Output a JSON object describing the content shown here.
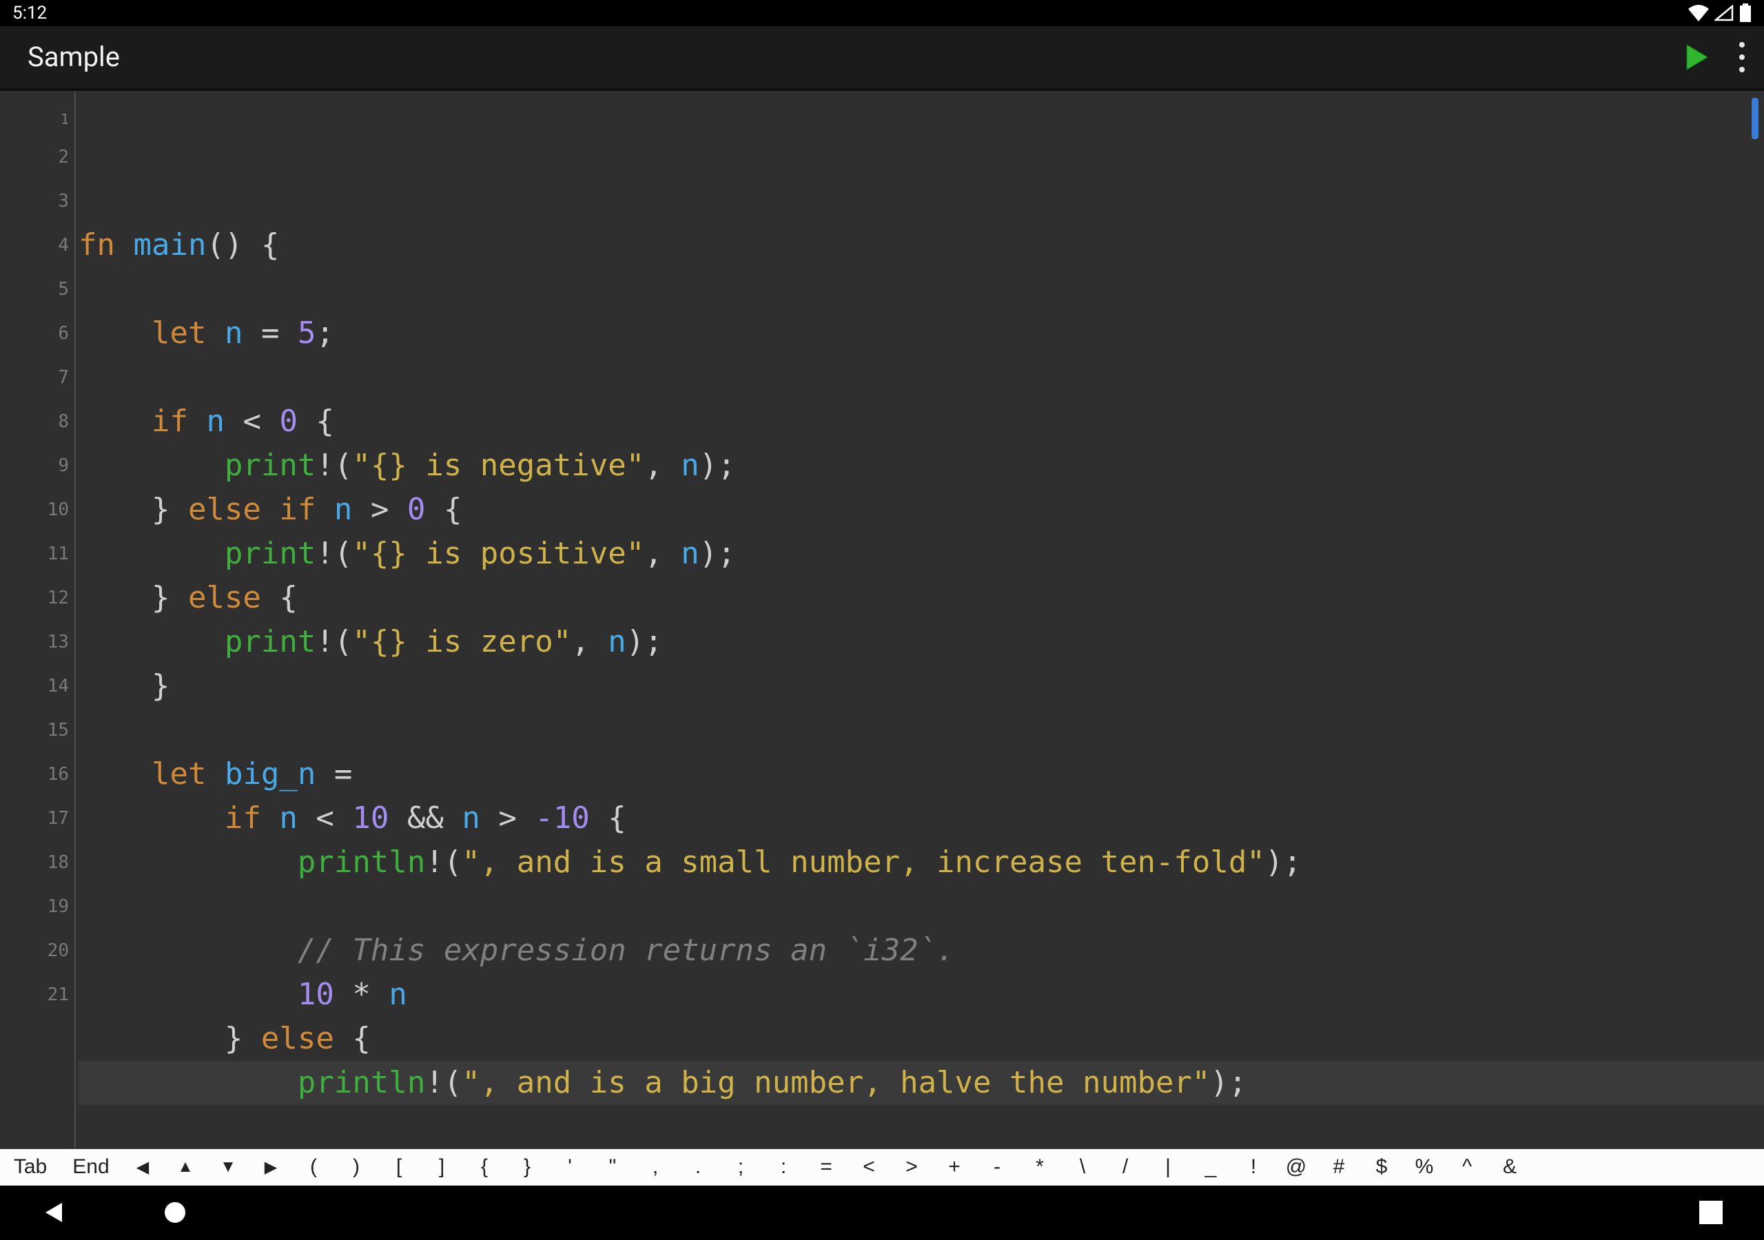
{
  "status": {
    "time": "5:12"
  },
  "appbar": {
    "title": "Sample"
  },
  "editor": {
    "totalLines": 21,
    "highlightLine": 20,
    "lines": [
      {
        "n": 1,
        "tokens": [
          [
            "kw",
            "fn"
          ],
          [
            "op",
            " "
          ],
          [
            "fnm",
            "main"
          ],
          [
            "op",
            "() {"
          ]
        ]
      },
      {
        "n": 2,
        "tokens": []
      },
      {
        "n": 3,
        "tokens": [
          [
            "op",
            "    "
          ],
          [
            "kw",
            "let"
          ],
          [
            "op",
            " "
          ],
          [
            "fnm",
            "n"
          ],
          [
            "op",
            " = "
          ],
          [
            "num",
            "5"
          ],
          [
            "op",
            ";"
          ]
        ]
      },
      {
        "n": 4,
        "tokens": []
      },
      {
        "n": 5,
        "tokens": [
          [
            "op",
            "    "
          ],
          [
            "kw",
            "if"
          ],
          [
            "op",
            " "
          ],
          [
            "fnm",
            "n"
          ],
          [
            "op",
            " < "
          ],
          [
            "num",
            "0"
          ],
          [
            "op",
            " {"
          ]
        ]
      },
      {
        "n": 6,
        "tokens": [
          [
            "op",
            "        "
          ],
          [
            "mac",
            "print"
          ],
          [
            "op",
            "!("
          ],
          [
            "str",
            "\"{} is negative\""
          ],
          [
            "op",
            ", "
          ],
          [
            "fnm",
            "n"
          ],
          [
            "op",
            ");"
          ]
        ]
      },
      {
        "n": 7,
        "tokens": [
          [
            "op",
            "    } "
          ],
          [
            "kw",
            "else"
          ],
          [
            "op",
            " "
          ],
          [
            "kw",
            "if"
          ],
          [
            "op",
            " "
          ],
          [
            "fnm",
            "n"
          ],
          [
            "op",
            " > "
          ],
          [
            "num",
            "0"
          ],
          [
            "op",
            " {"
          ]
        ]
      },
      {
        "n": 8,
        "tokens": [
          [
            "op",
            "        "
          ],
          [
            "mac",
            "print"
          ],
          [
            "op",
            "!("
          ],
          [
            "str",
            "\"{} is positive\""
          ],
          [
            "op",
            ", "
          ],
          [
            "fnm",
            "n"
          ],
          [
            "op",
            ");"
          ]
        ]
      },
      {
        "n": 9,
        "tokens": [
          [
            "op",
            "    } "
          ],
          [
            "kw",
            "else"
          ],
          [
            "op",
            " {"
          ]
        ]
      },
      {
        "n": 10,
        "tokens": [
          [
            "op",
            "        "
          ],
          [
            "mac",
            "print"
          ],
          [
            "op",
            "!("
          ],
          [
            "str",
            "\"{} is zero\""
          ],
          [
            "op",
            ", "
          ],
          [
            "fnm",
            "n"
          ],
          [
            "op",
            ");"
          ]
        ]
      },
      {
        "n": 11,
        "tokens": [
          [
            "op",
            "    }"
          ]
        ]
      },
      {
        "n": 12,
        "tokens": []
      },
      {
        "n": 13,
        "tokens": [
          [
            "op",
            "    "
          ],
          [
            "kw",
            "let"
          ],
          [
            "op",
            " "
          ],
          [
            "fnm",
            "big_n"
          ],
          [
            "op",
            " ="
          ]
        ]
      },
      {
        "n": 14,
        "tokens": [
          [
            "op",
            "        "
          ],
          [
            "kw",
            "if"
          ],
          [
            "op",
            " "
          ],
          [
            "fnm",
            "n"
          ],
          [
            "op",
            " < "
          ],
          [
            "num",
            "10"
          ],
          [
            "op",
            " && "
          ],
          [
            "fnm",
            "n"
          ],
          [
            "op",
            " > "
          ],
          [
            "num",
            "-10"
          ],
          [
            "op",
            " {"
          ]
        ]
      },
      {
        "n": 15,
        "tokens": [
          [
            "op",
            "            "
          ],
          [
            "mac",
            "println"
          ],
          [
            "op",
            "!("
          ],
          [
            "str",
            "\", and is a small number, increase ten-fold\""
          ],
          [
            "op",
            ");"
          ]
        ]
      },
      {
        "n": 16,
        "tokens": []
      },
      {
        "n": 17,
        "tokens": [
          [
            "op",
            "            "
          ],
          [
            "cmt",
            "// This expression returns an `i32`."
          ]
        ]
      },
      {
        "n": 18,
        "tokens": [
          [
            "op",
            "            "
          ],
          [
            "num",
            "10"
          ],
          [
            "op",
            " * "
          ],
          [
            "fnm",
            "n"
          ]
        ]
      },
      {
        "n": 19,
        "tokens": [
          [
            "op",
            "        } "
          ],
          [
            "kw",
            "else"
          ],
          [
            "op",
            " {"
          ]
        ]
      },
      {
        "n": 20,
        "tokens": [
          [
            "op",
            "            "
          ],
          [
            "mac",
            "println"
          ],
          [
            "op",
            "!("
          ],
          [
            "str",
            "\", and is a big number, halve the number\""
          ],
          [
            "op",
            ");"
          ]
        ]
      },
      {
        "n": 21,
        "tokens": []
      }
    ]
  },
  "kbd": {
    "keys": [
      "Tab",
      "End",
      "◀",
      "▲",
      "▼",
      "▶",
      "(",
      ")",
      "[",
      "]",
      "{",
      "}",
      "'",
      "\"",
      ",",
      ".",
      ";",
      ":",
      "=",
      "<",
      ">",
      "+",
      "-",
      "*",
      "\\",
      "/",
      "|",
      "_",
      "!",
      "@",
      "#",
      "$",
      "%",
      "^",
      "&"
    ]
  }
}
